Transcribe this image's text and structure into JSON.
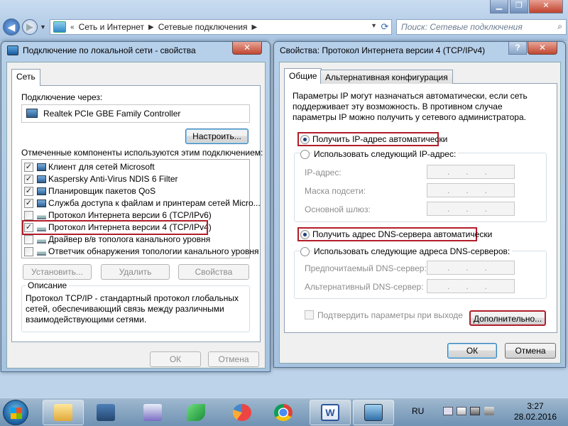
{
  "explorer": {
    "breadcrumb": [
      "Сеть и Интернет",
      "Сетевые подключения"
    ],
    "search_placeholder": "Поиск: Сетевые подключения"
  },
  "lan_dialog": {
    "title": "Подключение по локальной сети - свойства",
    "tab": "Сеть",
    "connect_via_label": "Подключение через:",
    "adapter": "Realtek PCIe GBE Family Controller",
    "configure_button": "Настроить...",
    "components_label": "Отмеченные компоненты используются этим подключением:",
    "components": [
      {
        "label": "Клиент для сетей Microsoft",
        "checked": true,
        "icon": "network-client-icon"
      },
      {
        "label": "Kaspersky Anti-Virus NDIS 6 Filter",
        "checked": true,
        "icon": "network-service-icon"
      },
      {
        "label": "Планировщик пакетов QoS",
        "checked": true,
        "icon": "network-service-icon"
      },
      {
        "label": "Служба доступа к файлам и принтерам сетей Micro...",
        "checked": true,
        "icon": "network-service-icon"
      },
      {
        "label": "Протокол Интернета версии 6 (TCP/IPv6)",
        "checked": false,
        "icon": "protocol-icon"
      },
      {
        "label": "Протокол Интернета версии 4 (TCP/IPv4)",
        "checked": true,
        "icon": "protocol-icon",
        "highlighted": true
      },
      {
        "label": "Драйвер в/в тополога канального уровня",
        "checked": false,
        "icon": "protocol-icon"
      },
      {
        "label": "Ответчик обнаружения топологии канального уровня",
        "checked": false,
        "icon": "protocol-icon"
      }
    ],
    "install_button": "Установить...",
    "remove_button": "Удалить",
    "properties_button": "Свойства",
    "description_label": "Описание",
    "description_text": "Протокол TCP/IP - стандартный протокол глобальных сетей, обеспечивающий связь между различными взаимодействующими сетями.",
    "ok_button": "ОК",
    "cancel_button": "Отмена"
  },
  "ipv4_dialog": {
    "title": "Свойства: Протокол Интернета версии 4 (TCP/IPv4)",
    "tabs": [
      "Общие",
      "Альтернативная конфигурация"
    ],
    "info_text": "Параметры IP могут назначаться автоматически, если сеть поддерживает эту возможность. В противном случае параметры IP можно получить у сетевого администратора.",
    "ip_auto": "Получить IP-адрес автоматически",
    "ip_manual": "Использовать следующий IP-адрес:",
    "ip_address": "IP-адрес:",
    "subnet_mask": "Маска подсети:",
    "gateway": "Основной шлюз:",
    "dns_auto": "Получить адрес DNS-сервера автоматически",
    "dns_manual": "Использовать следующие адреса DNS-серверов:",
    "dns_preferred": "Предпочитаемый DNS-сервер:",
    "dns_alternate": "Альтернативный DNS-сервер:",
    "validate_on_exit": "Подтвердить параметры при выходе",
    "advanced_button": "Дополнительно...",
    "ok_button": "ОК",
    "cancel_button": "Отмена",
    "empty_ip": "...",
    "ip_auto_selected": true,
    "dns_auto_selected": true
  },
  "taskbar": {
    "language": "RU",
    "time": "3:27",
    "date": "28.02.2016"
  },
  "colors": {
    "highlight": "#b21d2a",
    "dialog_frame": "#a6c2e1",
    "taskbar": "#7a9cbc"
  }
}
